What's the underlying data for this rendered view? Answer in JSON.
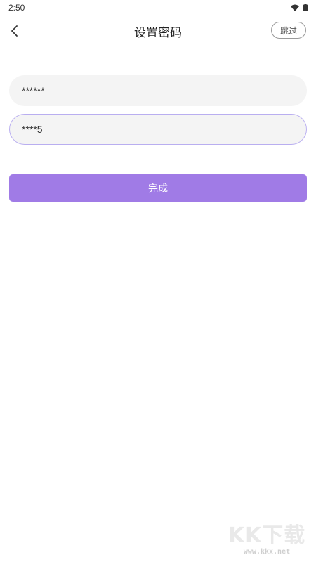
{
  "status_bar": {
    "time": "2:50",
    "icons": [
      "wifi-icon",
      "battery-icon"
    ]
  },
  "app_bar": {
    "back_icon": "chevron-left-icon",
    "title": "设置密码",
    "skip_label": "跳过"
  },
  "form": {
    "password_value": "******",
    "confirm_password_value": "****5",
    "done_label": "完成"
  },
  "watermark": {
    "logo_text": "KK下载",
    "url": "www.kkx.net"
  },
  "colors": {
    "accent": "#a07be6",
    "focus_border": "#b9aef0",
    "field_bg": "#f4f4f4"
  }
}
